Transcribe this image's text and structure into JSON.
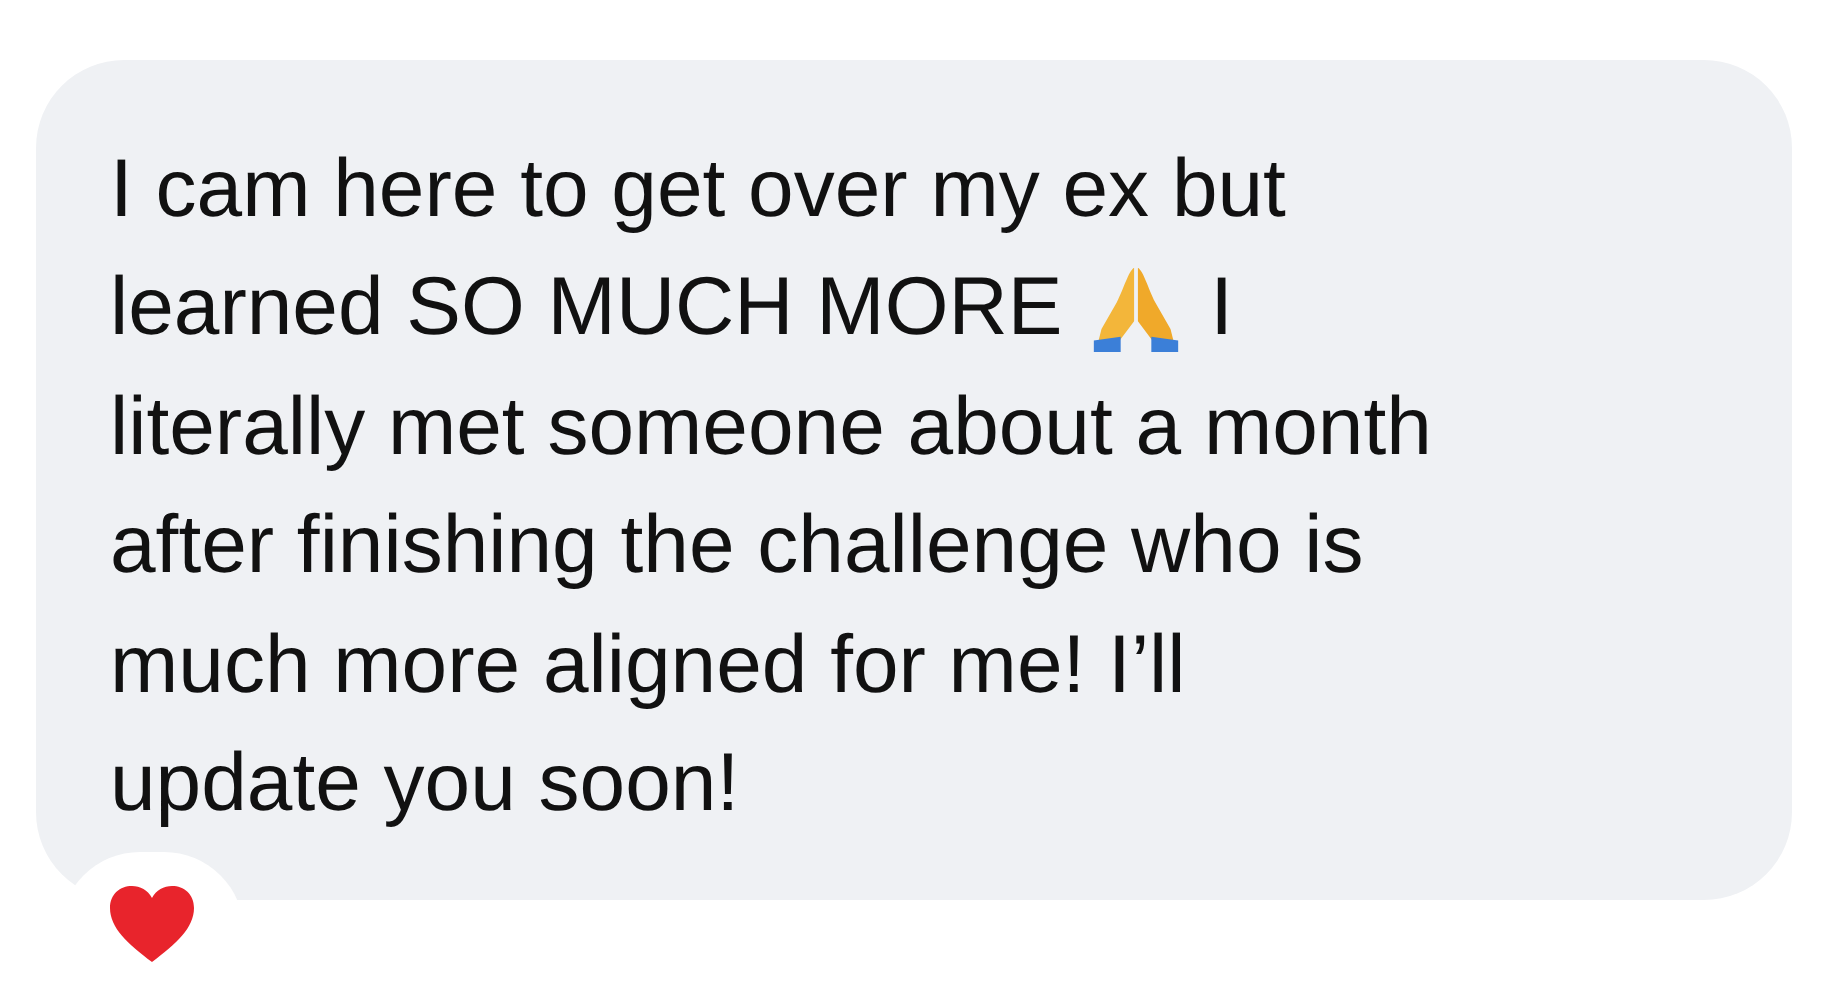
{
  "message": {
    "lines": [
      [
        {
          "kind": "text",
          "text": "I cam here to get over my ex but"
        }
      ],
      [
        {
          "kind": "text",
          "text": "learned SO MUCH MORE"
        },
        {
          "kind": "emoji"
        },
        {
          "kind": "text",
          "text": "I"
        }
      ],
      [
        {
          "kind": "text",
          "text": "literally met someone about a month"
        }
      ],
      [
        {
          "kind": "text",
          "text": "after finishing the challenge who is"
        }
      ],
      [
        {
          "kind": "text",
          "text": "much more aligned for me! I’ll"
        }
      ],
      [
        {
          "kind": "text",
          "text": "update you soon!"
        }
      ]
    ]
  }
}
